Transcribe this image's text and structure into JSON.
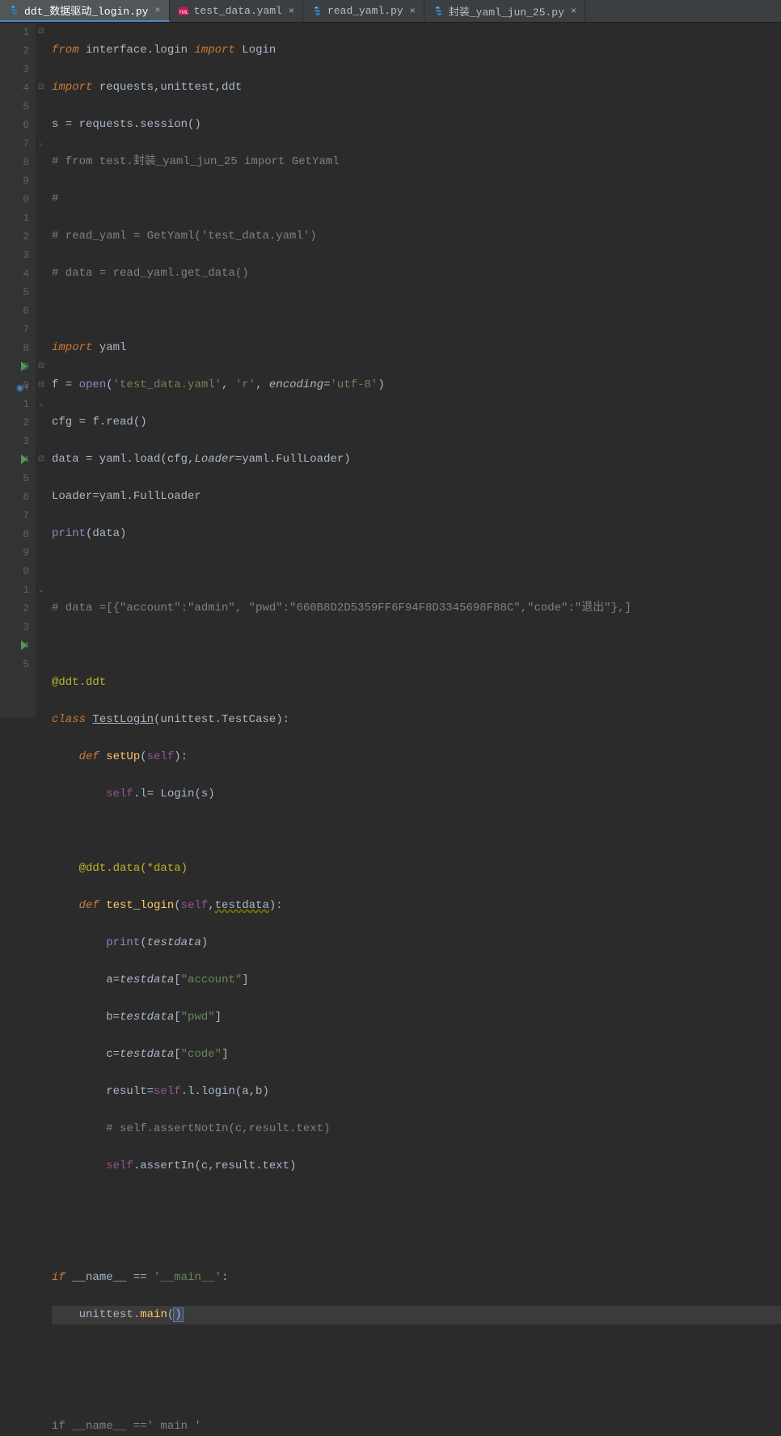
{
  "tabs": [
    {
      "label": "ddt_数据驱动_login.py",
      "type": "py",
      "active": true
    },
    {
      "label": "test_data.yaml",
      "type": "yaml",
      "active": false
    },
    {
      "label": "read_yaml.py",
      "type": "py",
      "active": false
    },
    {
      "label": "封装_yaml_jun_25.py",
      "type": "py",
      "active": false
    }
  ],
  "lines": {
    "1": "1",
    "2": "2",
    "3": "3",
    "4": "4",
    "5": "5",
    "6": "6",
    "7": "7",
    "8": "8",
    "9": "9",
    "10": "0",
    "11": "1",
    "12": "2",
    "13": "3",
    "14": "4",
    "15": "5",
    "16": "6",
    "17": "7",
    "18": "8",
    "19": "9",
    "20": "0",
    "21": "1",
    "22": "2",
    "23": "3",
    "24": "4",
    "25": "5",
    "26": "6",
    "27": "7",
    "28": "8",
    "29": "9",
    "30": "0",
    "31": "1",
    "32": "2",
    "33": "3",
    "34": "4",
    "35": "5"
  },
  "code": {
    "l1_from": "from",
    "l1_mod": " interface.login ",
    "l1_import": "import",
    "l1_name": " Login",
    "l2_import": "import",
    "l2_rest": " requests,unittest,ddt",
    "l3": "s = requests.session()",
    "l4": "# from test.封装_yaml_jun_25 import GetYaml",
    "l5": "#",
    "l6": "# read_yaml = GetYaml('test_data.yaml')",
    "l7": "# data = read_yaml.get_data()",
    "l9_import": "import",
    "l9_rest": " yaml",
    "l10_a": "f = ",
    "l10_open": "open",
    "l10_p": "(",
    "l10_s1": "'test_data.yaml'",
    "l10_c": ", ",
    "l10_s2": "'r'",
    "l10_c2": ", ",
    "l10_kw": "encoding",
    "l10_eq": "=",
    "l10_s3": "'utf-8'",
    "l10_pe": ")",
    "l11": "cfg = f.read()",
    "l12_a": "data = yaml.load(cfg,",
    "l12_kw": "Loader",
    "l12_eq": "=",
    "l12_b": "yaml.FullLoader)",
    "l13": "Loader=yaml.FullLoader",
    "l14_a": "print",
    "l14_b": "(data)",
    "l16": "# data =[{\"account\":\"admin\", \"pwd\":\"660B8D2D5359FF6F94F8D3345698F88C\",\"code\":\"退出\"},]",
    "l18": "@ddt.ddt",
    "l19_class": "class ",
    "l19_name": "TestLogin",
    "l19_rest": "(unittest.TestCase):",
    "l20_def": "def ",
    "l20_fn": "setUp",
    "l20_p": "(",
    "l20_self": "self",
    "l20_pe": "):",
    "l21_a": "self",
    "l21_b": ".l= Login(s)",
    "l23_a": "@ddt.data(*data)",
    "l24_def": "def ",
    "l24_fn": "test_login",
    "l24_p": "(",
    "l24_self": "self",
    "l24_c": ",",
    "l24_td": "testdata",
    "l24_pe": "):",
    "l25_a": "print",
    "l25_p": "(",
    "l25_td": "testdata",
    "l25_pe": ")",
    "l26_a": "a=",
    "l26_td": "testdata",
    "l26_b": "[",
    "l26_s": "\"account\"",
    "l26_e": "]",
    "l27_a": "b=",
    "l27_td": "testdata",
    "l27_b": "[",
    "l27_s": "\"pwd\"",
    "l27_e": "]",
    "l28_a": "c=",
    "l28_td": "testdata",
    "l28_b": "[",
    "l28_s": "\"code\"",
    "l28_e": "]",
    "l29_a": "result=",
    "l29_self": "self",
    "l29_b": ".l.login(a,b)",
    "l30": "# self.assertNotIn(c,result.text)",
    "l31_self": "self",
    "l31_b": ".assertIn(c,result.text)",
    "l34_if": "if ",
    "l34_name": "__name__ == ",
    "l34_s": "'__main__'",
    "l34_c": ":",
    "l35_a": "unittest.",
    "l35_fn": "main",
    "l35_p": "(",
    "l35_pe": ")",
    "hint": "if __name__ ==' main '"
  }
}
